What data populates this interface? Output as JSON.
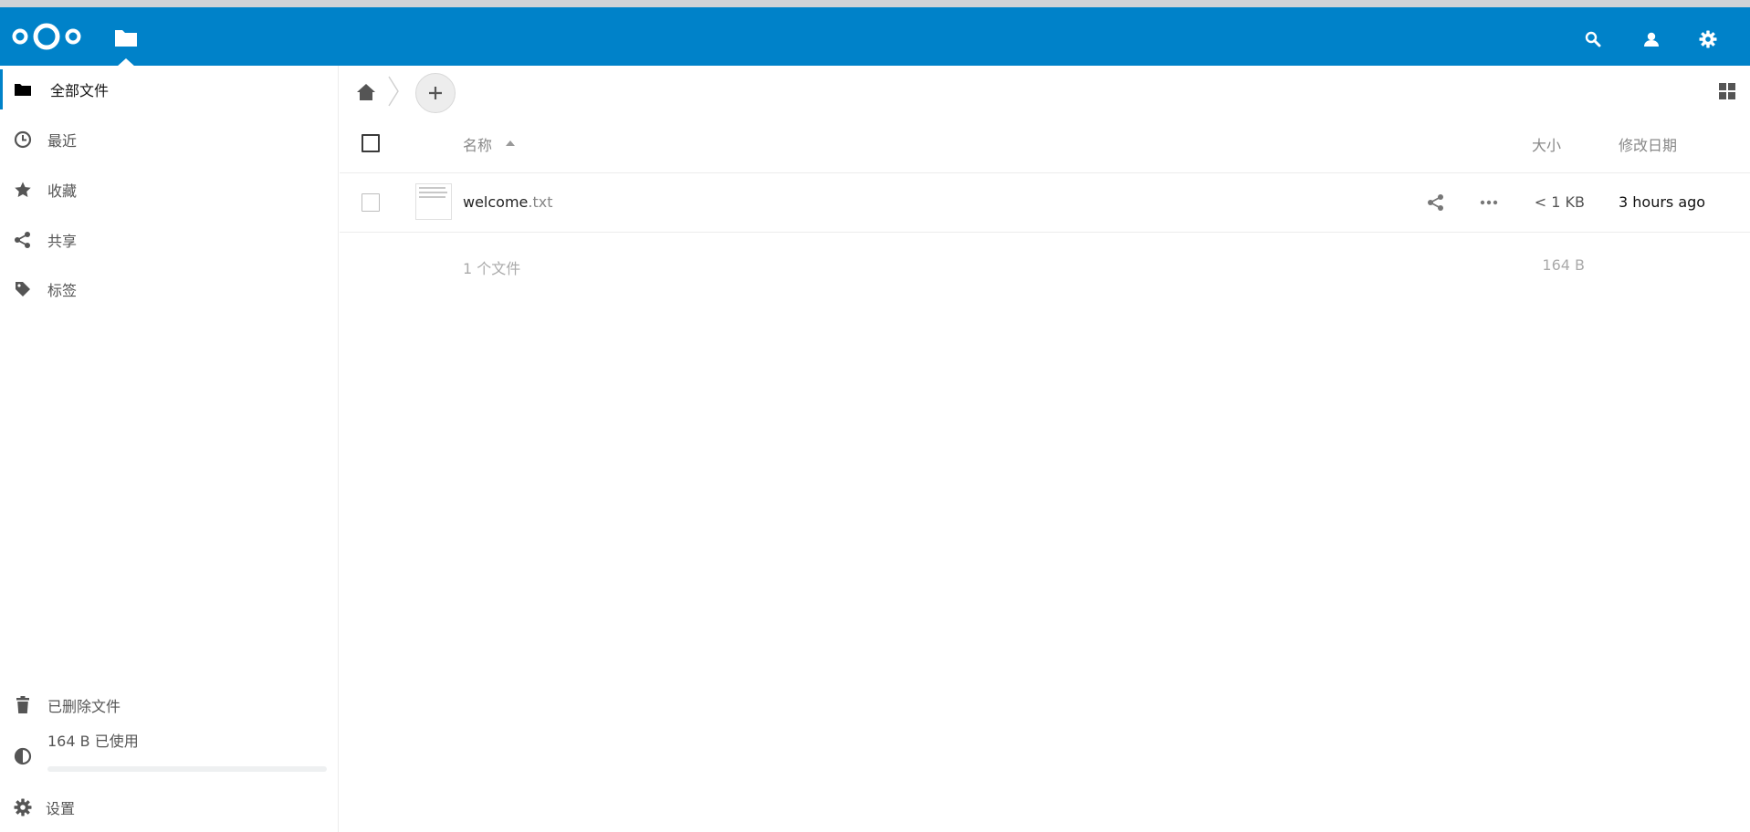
{
  "colors": {
    "brand": "#0082c9",
    "quota_fill": "#0082c9"
  },
  "header": {
    "logo_icon": "nextcloud-logo",
    "app_icon": "files-folder-icon",
    "right_icons": [
      "search-icon",
      "contacts-icon",
      "settings-gear-icon"
    ]
  },
  "sidebar": {
    "items": [
      {
        "label": "全部文件",
        "icon": "folder-icon"
      },
      {
        "label": "最近",
        "icon": "clock-icon"
      },
      {
        "label": "收藏",
        "icon": "star-icon"
      },
      {
        "label": "共享",
        "icon": "share-icon"
      },
      {
        "label": "标签",
        "icon": "tag-icon"
      }
    ],
    "bottom": {
      "trash_label": "已删除文件",
      "quota_label": "164 B 已使用",
      "quota_fraction": 0.0,
      "settings_label": "设置"
    }
  },
  "controls": {
    "breadcrumb_home_icon": "home-icon",
    "new_button_icon": "plus-icon",
    "view_toggle_icon": "grid-view-icon"
  },
  "table": {
    "columns": {
      "name": "名称",
      "size": "大小",
      "modified": "修改日期"
    },
    "rows": [
      {
        "name_base": "welcome",
        "name_ext": ".txt",
        "size": "< 1 KB",
        "modified": "3 hours ago"
      }
    ],
    "summary": {
      "count": "1 个文件",
      "size": "164 B"
    }
  }
}
